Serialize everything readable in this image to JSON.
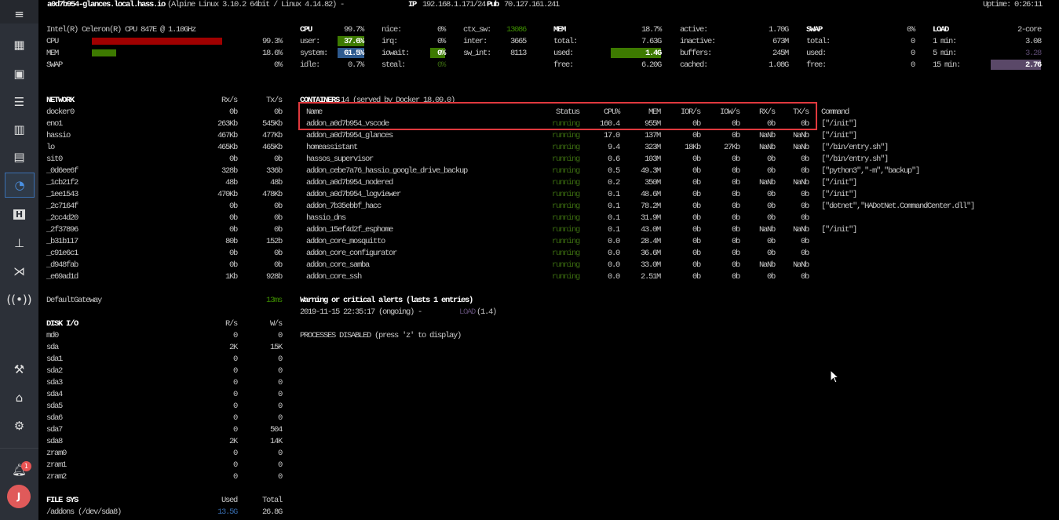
{
  "header": {
    "hostname": "a0d7b954-glances.local.hass.io",
    "os": "(Alpine Linux 3.10.2 64bit / Linux 4.14.82) -",
    "ip_label": "IP",
    "ip": "192.168.1.171/24",
    "pub_label": "Pub",
    "pub_ip": "70.127.161.241",
    "uptime": "Uptime: 0:26:11"
  },
  "quicklook": {
    "cpu_name": "Intel(R) Celeron(R) CPU 847E @ 1.10GHz",
    "rows": [
      {
        "label": "CPU",
        "value": "99.3%",
        "fraction": 0.993
      },
      {
        "label": "MEM",
        "value": "18.6%",
        "fraction": 0.186
      },
      {
        "label": "SWAP",
        "value": "0%",
        "fraction": 0
      }
    ],
    "colors": {
      "cpu": "#a00000",
      "mem": "#3d7a00"
    }
  },
  "cpu": {
    "title": "CPU",
    "total": "99.7%",
    "col1": [
      {
        "label": "user:",
        "value": "37.6%"
      },
      {
        "label": "system:",
        "value": "61.5%"
      },
      {
        "label": "idle:",
        "value": "0.7%"
      }
    ],
    "col2": [
      {
        "label": "nice:",
        "value": "0%"
      },
      {
        "label": "irq:",
        "value": "0%"
      },
      {
        "label": "iowait:",
        "value": "0%"
      },
      {
        "label": "steal:",
        "value": "0%"
      }
    ],
    "col3": [
      {
        "label": "ctx_sw:",
        "value": "13086"
      },
      {
        "label": "inter:",
        "value": "3665"
      },
      {
        "label": "sw_int:",
        "value": "8113"
      }
    ]
  },
  "mem": {
    "title": "MEM",
    "total": "18.7%",
    "col1": [
      {
        "label": "total:",
        "value": "7.63G"
      },
      {
        "label": "used:",
        "value": "1.4G"
      },
      {
        "label": "free:",
        "value": "6.20G"
      }
    ],
    "col2": [
      {
        "label": "active:",
        "value": "1.70G"
      },
      {
        "label": "inactive:",
        "value": "673M"
      },
      {
        "label": "buffers:",
        "value": "245M"
      },
      {
        "label": "cached:",
        "value": "1.08G"
      }
    ]
  },
  "swap": {
    "title": "SWAP",
    "total": "0%",
    "rows": [
      {
        "label": "total:",
        "value": "0"
      },
      {
        "label": "used:",
        "value": "0"
      },
      {
        "label": "free:",
        "value": "0"
      }
    ]
  },
  "load": {
    "title": "LOAD",
    "cores": "2-core",
    "rows": [
      {
        "label": "1 min:",
        "value": "3.08"
      },
      {
        "label": "5 min:",
        "value": "3.28"
      },
      {
        "label": "15 min:",
        "value": "2.76"
      }
    ]
  },
  "network": {
    "title": "NETWORK",
    "rx_header": "Rx/s",
    "tx_header": "Tx/s",
    "rows": [
      {
        "name": "docker0",
        "rx": "0b",
        "tx": "0b"
      },
      {
        "name": "eno1",
        "rx": "263Kb",
        "tx": "545Kb"
      },
      {
        "name": "hassio",
        "rx": "467Kb",
        "tx": "477Kb"
      },
      {
        "name": "lo",
        "rx": "465Kb",
        "tx": "465Kb"
      },
      {
        "name": "sit0",
        "rx": "0b",
        "tx": "0b"
      },
      {
        "name": "_0d6ee6f",
        "rx": "328b",
        "tx": "336b"
      },
      {
        "name": "_1cb21f2",
        "rx": "48b",
        "tx": "48b"
      },
      {
        "name": "_1ee1543",
        "rx": "470Kb",
        "tx": "478Kb"
      },
      {
        "name": "_2c7164f",
        "rx": "0b",
        "tx": "0b"
      },
      {
        "name": "_2cc4d20",
        "rx": "0b",
        "tx": "0b"
      },
      {
        "name": "_2f37896",
        "rx": "0b",
        "tx": "0b"
      },
      {
        "name": "_b31b117",
        "rx": "80b",
        "tx": "152b"
      },
      {
        "name": "_c91e6c1",
        "rx": "0b",
        "tx": "0b"
      },
      {
        "name": "_d948fab",
        "rx": "0b",
        "tx": "0b"
      },
      {
        "name": "_e69ad1d",
        "rx": "1Kb",
        "tx": "928b"
      }
    ],
    "gateway": {
      "name": "DefaultGateway",
      "value": "13ms"
    }
  },
  "disk": {
    "title": "DISK I/O",
    "r_header": "R/s",
    "w_header": "W/s",
    "rows": [
      {
        "name": "md0",
        "r": "0",
        "w": "0"
      },
      {
        "name": "sda",
        "r": "2K",
        "w": "15K"
      },
      {
        "name": "sda1",
        "r": "0",
        "w": "0"
      },
      {
        "name": "sda2",
        "r": "0",
        "w": "0"
      },
      {
        "name": "sda3",
        "r": "0",
        "w": "0"
      },
      {
        "name": "sda4",
        "r": "0",
        "w": "0"
      },
      {
        "name": "sda5",
        "r": "0",
        "w": "0"
      },
      {
        "name": "sda6",
        "r": "0",
        "w": "0"
      },
      {
        "name": "sda7",
        "r": "0",
        "w": "504"
      },
      {
        "name": "sda8",
        "r": "2K",
        "w": "14K"
      },
      {
        "name": "zram0",
        "r": "0",
        "w": "0"
      },
      {
        "name": "zram1",
        "r": "0",
        "w": "0"
      },
      {
        "name": "zram2",
        "r": "0",
        "w": "0"
      }
    ]
  },
  "filesys": {
    "title": "FILE SYS",
    "used_header": "Used",
    "total_header": "Total",
    "rows": [
      {
        "name": "/addons (/dev/sda8)",
        "used": "13.5G",
        "total": "26.8G"
      }
    ]
  },
  "containers": {
    "title": "CONTAINERS",
    "subtitle": "14 (served by Docker 18.09.0)",
    "headers": {
      "name": "Name",
      "status": "Status",
      "cpu": "CPU%",
      "mem": "MEM",
      "ior": "IOR/s",
      "iow": "IOW/s",
      "rx": "RX/s",
      "tx": "TX/s",
      "command": "Command"
    },
    "rows": [
      {
        "name": "addon_a0d7b954_vscode",
        "status": "running",
        "cpu": "160.4",
        "mem": "955M",
        "ior": "0b",
        "iow": "0b",
        "rx": "0b",
        "tx": "0b",
        "command": "[\"/init\"]"
      },
      {
        "name": "addon_a0d7b954_glances",
        "status": "running",
        "cpu": "17.0",
        "mem": "137M",
        "ior": "0b",
        "iow": "0b",
        "rx": "NaNb",
        "tx": "NaNb",
        "command": "[\"/init\"]"
      },
      {
        "name": "homeassistant",
        "status": "running",
        "cpu": "9.4",
        "mem": "323M",
        "ior": "18Kb",
        "iow": "27Kb",
        "rx": "NaNb",
        "tx": "NaNb",
        "command": "[\"/bin/entry.sh\"]"
      },
      {
        "name": "hassos_supervisor",
        "status": "running",
        "cpu": "0.6",
        "mem": "103M",
        "ior": "0b",
        "iow": "0b",
        "rx": "0b",
        "tx": "0b",
        "command": "[\"/bin/entry.sh\"]"
      },
      {
        "name": "addon_cebe7a76_hassio_google_drive_backup",
        "status": "running",
        "cpu": "0.5",
        "mem": "49.3M",
        "ior": "0b",
        "iow": "0b",
        "rx": "0b",
        "tx": "0b",
        "command": "[\"python3\",\"-m\",\"backup\"]"
      },
      {
        "name": "addon_a0d7b954_nodered",
        "status": "running",
        "cpu": "0.2",
        "mem": "350M",
        "ior": "0b",
        "iow": "0b",
        "rx": "NaNb",
        "tx": "NaNb",
        "command": "[\"/init\"]"
      },
      {
        "name": "addon_a0d7b954_logviewer",
        "status": "running",
        "cpu": "0.1",
        "mem": "48.6M",
        "ior": "0b",
        "iow": "0b",
        "rx": "0b",
        "tx": "0b",
        "command": "[\"/init\"]"
      },
      {
        "name": "addon_7b35ebbf_hacc",
        "status": "running",
        "cpu": "0.1",
        "mem": "78.2M",
        "ior": "0b",
        "iow": "0b",
        "rx": "0b",
        "tx": "0b",
        "command": "[\"dotnet\",\"HADotNet.CommandCenter.dll\"]"
      },
      {
        "name": "hassio_dns",
        "status": "running",
        "cpu": "0.1",
        "mem": "31.9M",
        "ior": "0b",
        "iow": "0b",
        "rx": "0b",
        "tx": "0b",
        "command": ""
      },
      {
        "name": "addon_15ef4d2f_esphome",
        "status": "running",
        "cpu": "0.1",
        "mem": "43.0M",
        "ior": "0b",
        "iow": "0b",
        "rx": "NaNb",
        "tx": "NaNb",
        "command": "[\"/init\"]"
      },
      {
        "name": "addon_core_mosquitto",
        "status": "running",
        "cpu": "0.0",
        "mem": "28.4M",
        "ior": "0b",
        "iow": "0b",
        "rx": "0b",
        "tx": "0b",
        "command": ""
      },
      {
        "name": "addon_core_configurator",
        "status": "running",
        "cpu": "0.0",
        "mem": "36.6M",
        "ior": "0b",
        "iow": "0b",
        "rx": "0b",
        "tx": "0b",
        "command": ""
      },
      {
        "name": "addon_core_samba",
        "status": "running",
        "cpu": "0.0",
        "mem": "33.0M",
        "ior": "0b",
        "iow": "0b",
        "rx": "NaNb",
        "tx": "NaNb",
        "command": ""
      },
      {
        "name": "addon_core_ssh",
        "status": "running",
        "cpu": "0.0",
        "mem": "2.51M",
        "ior": "0b",
        "iow": "0b",
        "rx": "0b",
        "tx": "0b",
        "command": ""
      }
    ]
  },
  "alerts": {
    "title": "Warning or critical alerts (lasts 1 entries)",
    "entry_time": "2019-11-15 22:35:17 (ongoing) -",
    "entry_type": "LOAD",
    "entry_value": "(1.4)"
  },
  "processes": {
    "message": "PROCESSES DISABLED (press 'z' to display)"
  },
  "sidebar": {
    "notification_count": "1",
    "avatar_initial": "J",
    "items": [
      "menu",
      "overview",
      "map",
      "logbook",
      "history",
      "hassio",
      "glances",
      "hacs",
      "network",
      "vscode",
      "zigbee",
      "developer-tools",
      "supervisor",
      "settings"
    ]
  }
}
